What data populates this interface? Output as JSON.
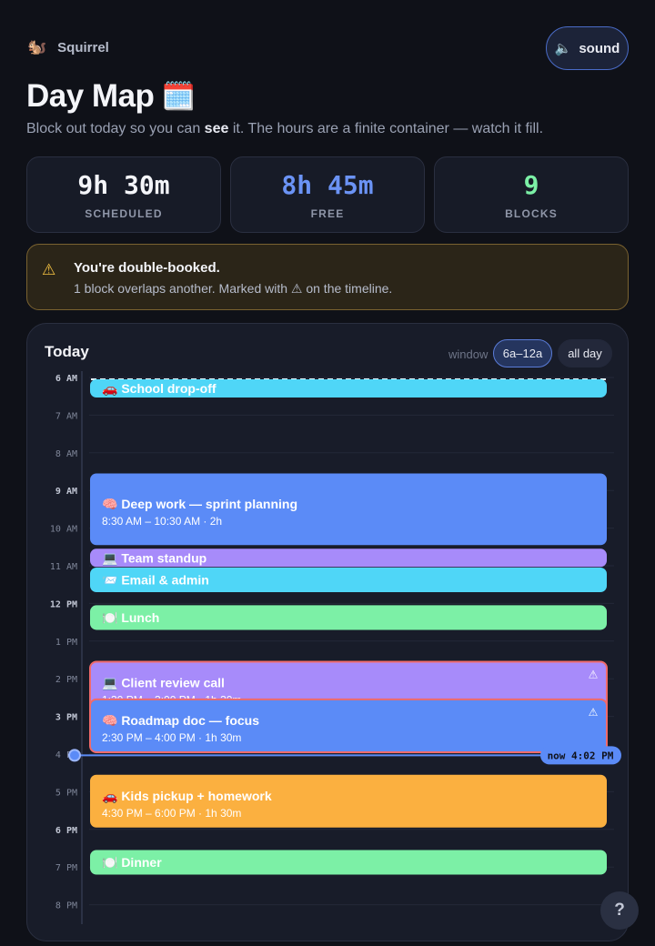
{
  "header": {
    "brand_icon": "🐿️",
    "brand_name": "Squirrel",
    "sound_icon": "🔈",
    "sound_label": "sound",
    "title": "Day Map",
    "title_icon": "🗓️",
    "subtitle_before": "Block out today so you can ",
    "subtitle_em": "see",
    "subtitle_after": " it. The hours are a finite container — watch it fill."
  },
  "stats": [
    {
      "value": "9h 30m",
      "label": "SCHEDULED",
      "color": "#f4f5f9"
    },
    {
      "value": "8h 45m",
      "label": "FREE",
      "color": "#6b93f5"
    },
    {
      "value": "9",
      "label": "BLOCKS",
      "color": "#7cf0a6"
    }
  ],
  "alert": {
    "icon": "warning-icon",
    "title": "You're double-booked.",
    "body": "1 block overlaps another. Marked with ⚠ on the timeline."
  },
  "timeline": {
    "title": "Today",
    "window_label": "window",
    "window_options": [
      "6a–12a",
      "all day"
    ],
    "window_selected": "6a–12a",
    "hours": [
      {
        "label": "6 AM",
        "hour": 6,
        "major": true
      },
      {
        "label": "7 AM",
        "hour": 7,
        "major": false
      },
      {
        "label": "8 AM",
        "hour": 8,
        "major": false
      },
      {
        "label": "9 AM",
        "hour": 9,
        "major": true
      },
      {
        "label": "10 AM",
        "hour": 10,
        "major": false
      },
      {
        "label": "11 AM",
        "hour": 11,
        "major": false
      },
      {
        "label": "12 PM",
        "hour": 12,
        "major": true
      },
      {
        "label": "1 PM",
        "hour": 13,
        "major": false
      },
      {
        "label": "2 PM",
        "hour": 14,
        "major": false
      },
      {
        "label": "3 PM",
        "hour": 15,
        "major": true
      },
      {
        "label": "4 PM",
        "hour": 16,
        "major": false
      },
      {
        "label": "5 PM",
        "hour": 17,
        "major": false
      },
      {
        "label": "6 PM",
        "hour": 18,
        "major": true
      },
      {
        "label": "7 PM",
        "hour": 19,
        "major": false
      },
      {
        "label": "8 PM",
        "hour": 20,
        "major": false
      }
    ],
    "blocks": [
      {
        "icon": "🚗",
        "title": "School drop-off",
        "time": "",
        "start": 6.0,
        "end": 6.5,
        "color": "#4fd6f7",
        "conflict": false
      },
      {
        "icon": "🧠",
        "title": "Deep work — sprint planning",
        "time": "8:30 AM – 10:30 AM · 2h",
        "start": 8.5,
        "end": 10.5,
        "color": "#5b8bf7",
        "conflict": false
      },
      {
        "icon": "💻",
        "title": "Team standup",
        "time": "",
        "start": 10.5,
        "end": 11.0,
        "color": "#a78bfa",
        "conflict": false
      },
      {
        "icon": "📨",
        "title": "Email & admin",
        "time": "",
        "start": 11.0,
        "end": 11.75,
        "color": "#4fd6f7",
        "conflict": false
      },
      {
        "icon": "🍽️",
        "title": "Lunch",
        "time": "",
        "start": 12.0,
        "end": 12.75,
        "color": "#7cf0a6",
        "conflict": false
      },
      {
        "icon": "💻",
        "title": "Client review call",
        "time": "1:30 PM – 3:00 PM · 1h 30m",
        "start": 13.5,
        "end": 15.0,
        "color": "#a78bfa",
        "conflict": true
      },
      {
        "icon": "🧠",
        "title": "Roadmap doc — focus",
        "time": "2:30 PM – 4:00 PM · 1h 30m",
        "start": 14.5,
        "end": 16.0,
        "color": "#5b8bf7",
        "conflict": true
      },
      {
        "icon": "🚗",
        "title": "Kids pickup + homework",
        "time": "4:30 PM – 6:00 PM · 1h 30m",
        "start": 16.5,
        "end": 18.0,
        "color": "#fbb040",
        "conflict": false
      },
      {
        "icon": "🍽️",
        "title": "Dinner",
        "time": "",
        "start": 18.5,
        "end": 19.25,
        "color": "#7cf0a6",
        "conflict": false
      }
    ],
    "now_label": "now 4:02 PM",
    "now_hour": 16.0333
  },
  "help_label": "?"
}
